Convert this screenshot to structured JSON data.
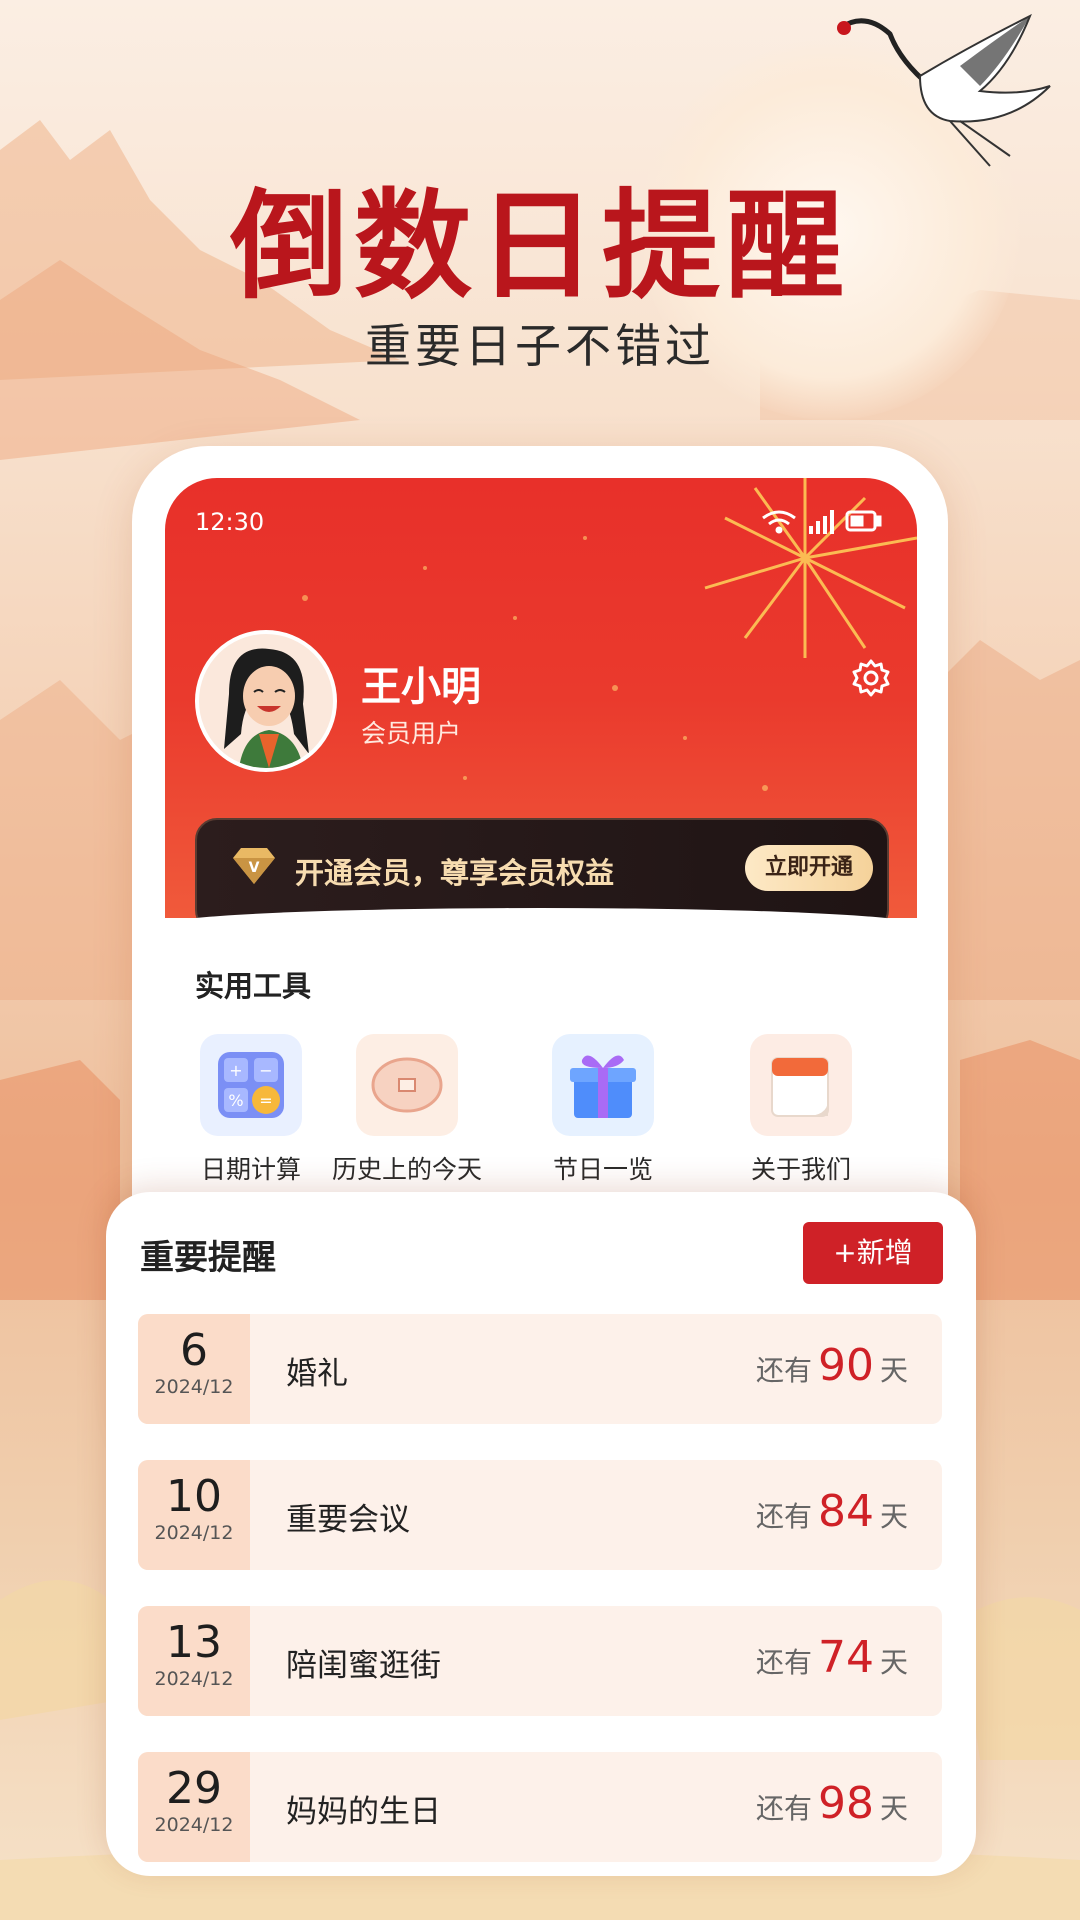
{
  "headline": "倒数日提醒",
  "subline": "重要日子不错过",
  "colors": {
    "brand_red": "#cf2127",
    "headline_red": "#b9161c",
    "vip_gold": "#f7dcb0"
  },
  "phone": {
    "status_time": "12:30",
    "status_icons": [
      "wifi-icon",
      "signal-icon",
      "battery-icon"
    ],
    "user": {
      "name": "王小明",
      "level": "会员用户"
    },
    "vip": {
      "text": "开通会员，尊享会员权益",
      "button": "立即开通"
    },
    "tools": {
      "title": "实用工具",
      "items": [
        {
          "label": "日期计算",
          "icon": "calculator-icon"
        },
        {
          "label": "历史上的今天",
          "icon": "ancient-coin-icon"
        },
        {
          "label": "节日一览",
          "icon": "gift-box-icon"
        },
        {
          "label": "关于我们",
          "icon": "calendar-icon"
        }
      ]
    }
  },
  "reminders": {
    "title": "重要提醒",
    "add_label": "+新增",
    "prefix": "还有",
    "suffix": "天",
    "items": [
      {
        "day": "6",
        "month": "2024/12",
        "event": "婚礼",
        "days_left": "90"
      },
      {
        "day": "10",
        "month": "2024/12",
        "event": "重要会议",
        "days_left": "84"
      },
      {
        "day": "13",
        "month": "2024/12",
        "event": "陪闺蜜逛街",
        "days_left": "74"
      },
      {
        "day": "29",
        "month": "2024/12",
        "event": "妈妈的生日",
        "days_left": "98"
      }
    ]
  }
}
